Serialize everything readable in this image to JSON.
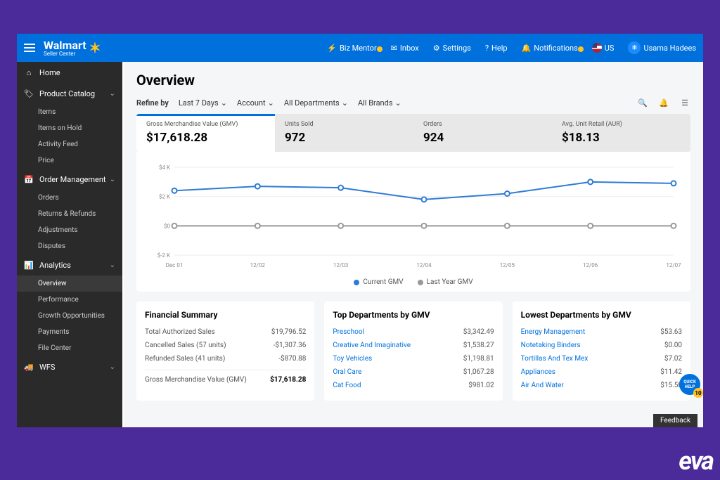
{
  "header": {
    "brand": "Walmart",
    "brand_sub": "Seller Center",
    "items": {
      "biz_mentor": "Biz Mentor",
      "inbox": "Inbox",
      "settings": "Settings",
      "help": "Help",
      "notifications": "Notifications",
      "country": "US",
      "user": "Usama Hadees"
    }
  },
  "sidebar": {
    "home": "Home",
    "product_catalog": {
      "label": "Product Catalog",
      "items": [
        "Items",
        "Items on Hold",
        "Activity Feed",
        "Price"
      ]
    },
    "order_mgmt": {
      "label": "Order Management",
      "items": [
        "Orders",
        "Returns & Refunds",
        "Adjustments",
        "Disputes"
      ]
    },
    "analytics": {
      "label": "Analytics",
      "items": [
        "Overview",
        "Performance",
        "Growth Opportunities",
        "Payments",
        "File Center"
      ]
    },
    "wfs": {
      "label": "WFS"
    }
  },
  "page": {
    "title": "Overview",
    "refine_label": "Refine by",
    "filters": [
      "Last 7 Days",
      "Account",
      "All Departments",
      "All Brands"
    ]
  },
  "kpis": [
    {
      "label": "Gross Merchandise Value (GMV)",
      "value": "$17,618.28"
    },
    {
      "label": "Units Sold",
      "value": "972"
    },
    {
      "label": "Orders",
      "value": "924"
    },
    {
      "label": "Avg. Unit Retail (AUR)",
      "value": "$18.13"
    }
  ],
  "chart_data": {
    "type": "line",
    "categories": [
      "Dec 01",
      "12/02",
      "12/03",
      "12/04",
      "12/05",
      "12/06",
      "12/07"
    ],
    "ylabel": "",
    "yticks": [
      "$4 K",
      "$2 K",
      "$0",
      "$-2 K"
    ],
    "ylim": [
      -2000,
      4000
    ],
    "series": [
      {
        "name": "Current GMV",
        "color": "#2e7cd6",
        "values": [
          2400,
          2700,
          2600,
          1800,
          2200,
          3000,
          2900
        ]
      },
      {
        "name": "Last Year GMV",
        "color": "#999999",
        "values": [
          0,
          0,
          0,
          0,
          0,
          0,
          0
        ]
      }
    ]
  },
  "financial": {
    "title": "Financial Summary",
    "rows": [
      {
        "label": "Total Authorized Sales",
        "value": "$19,796.52"
      },
      {
        "label": "Cancelled Sales (57 units)",
        "value": "-$1,307.36"
      },
      {
        "label": "Refunded Sales (41 units)",
        "value": "-$870.88"
      }
    ],
    "total": {
      "label": "Gross Merchandise Value (GMV)",
      "value": "$17,618.28"
    }
  },
  "top_dept": {
    "title": "Top Departments by GMV",
    "rows": [
      {
        "label": "Preschool",
        "value": "$3,342.49"
      },
      {
        "label": "Creative And Imaginative",
        "value": "$1,538.27"
      },
      {
        "label": "Toy Vehicles",
        "value": "$1,198.81"
      },
      {
        "label": "Oral Care",
        "value": "$1,067.28"
      },
      {
        "label": "Cat Food",
        "value": "$981.02"
      }
    ]
  },
  "low_dept": {
    "title": "Lowest Departments by GMV",
    "rows": [
      {
        "label": "Energy Management",
        "value": "$53.63"
      },
      {
        "label": "Notetaking Binders",
        "value": "$0.00"
      },
      {
        "label": "Tortillas And Tex Mex",
        "value": "$7.02"
      },
      {
        "label": "Appliances",
        "value": "$11.42"
      },
      {
        "label": "Air And Water",
        "value": "$15.50"
      }
    ]
  },
  "feedback": "Feedback",
  "quickhelp": {
    "label": "QUICK HELP",
    "badge": "10"
  },
  "eva": "eva"
}
